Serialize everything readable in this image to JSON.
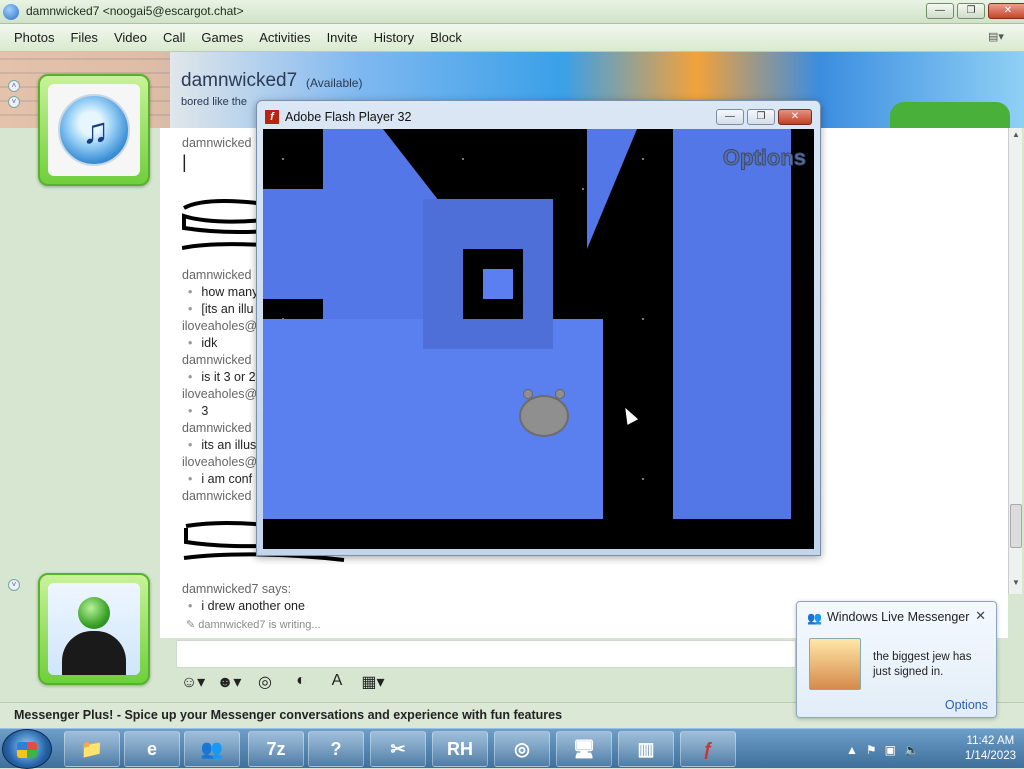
{
  "window": {
    "title": "damnwicked7 <noogai5@escargot.chat>",
    "btn_min": "—",
    "btn_max": "❐",
    "btn_close": "✕"
  },
  "menu": [
    "Photos",
    "Files",
    "Video",
    "Call",
    "Games",
    "Activities",
    "Invite",
    "History",
    "Block"
  ],
  "contact": {
    "name": "damnwicked7",
    "status": "(Available)",
    "message": "bored like the"
  },
  "chat": [
    {
      "type": "sender",
      "text": "damnwicked"
    },
    {
      "type": "cursor",
      "text": "|"
    },
    {
      "type": "sender",
      "text": "damnwicked"
    },
    {
      "type": "msg",
      "text": "how many"
    },
    {
      "type": "msg",
      "text": "[its an illu"
    },
    {
      "type": "sender",
      "text": "iloveaholes@"
    },
    {
      "type": "msg",
      "text": "idk"
    },
    {
      "type": "sender",
      "text": "damnwicked"
    },
    {
      "type": "msg",
      "text": "is it 3 or 2"
    },
    {
      "type": "sender",
      "text": "iloveaholes@"
    },
    {
      "type": "msg",
      "text": "3"
    },
    {
      "type": "sender",
      "text": "damnwicked"
    },
    {
      "type": "msg",
      "text": "its an illus"
    },
    {
      "type": "sender",
      "text": "iloveaholes@"
    },
    {
      "type": "msg",
      "text": "i am conf"
    },
    {
      "type": "sender",
      "text": "damnwicked"
    },
    {
      "type": "sender",
      "text": "damnwicked7 says:"
    },
    {
      "type": "msg",
      "text": "i drew another one"
    }
  ],
  "writing_status": "damnwicked7 is writing...",
  "statusbar": "Messenger Plus! - Spice up your Messenger conversations and experience with fun features",
  "flash": {
    "title": "Adobe Flash Player 32",
    "icon_letter": "f",
    "options_label": "Options"
  },
  "notification": {
    "title": "Windows Live Messenger",
    "body": "the biggest jew has just signed in.",
    "options": "Options",
    "close": "✕"
  },
  "taskbar": {
    "icons": [
      "explorer-icon",
      "ie-icon",
      "messenger-icon",
      "7zip-icon",
      "help-icon",
      "snipping-icon",
      "rh-icon",
      "chrome-icon",
      "computer-icon",
      "winrar-icon",
      "flash-icon"
    ],
    "labels": [
      "",
      "",
      "",
      "7z",
      "?",
      "✂",
      "RH",
      "◎",
      "",
      "",
      ""
    ],
    "time": "11:42 AM",
    "date": "1/14/2023"
  }
}
